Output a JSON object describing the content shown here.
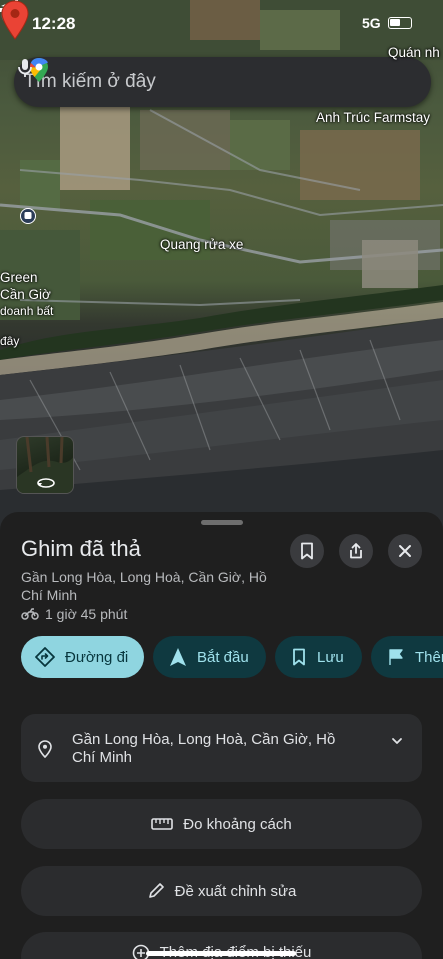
{
  "status_bar": {
    "time": "12:28",
    "network": "5G"
  },
  "search": {
    "placeholder": "Tìm kiếm ở đây"
  },
  "map": {
    "labels": {
      "quan_nh": "Quán nh",
      "anh_truc": "Anh Trúc Farmstay",
      "quang_rua_xe": "Quang rửa xe",
      "green": "Green",
      "can_gio": "Cần Giờ",
      "doanh_bat": "doanh bất",
      "day": "đây"
    }
  },
  "place": {
    "title": "Ghim đã thả",
    "address": "Gần Long Hòa, Long Hoà, Cần Giờ, Hồ Chí Minh",
    "travel_time": "1 giờ 45 phút",
    "travel_icon": "motorbike-icon"
  },
  "chips": {
    "directions": "Đường đi",
    "start": "Bắt đầu",
    "save": "Lưu",
    "more": "Thên"
  },
  "address_card": {
    "text": "Gần Long Hòa, Long Hoà, Cần Giờ, Hồ Chí Minh"
  },
  "actions": {
    "measure": "Đo khoảng cách",
    "suggest_edit": "Đề xuất chỉnh sửa",
    "add_place": "Thêm địa điểm bị thiếu"
  },
  "colors": {
    "accent": "#8fd5e0",
    "chip_bg": "#0f3940",
    "pin_red": "#ea4335",
    "sheet_bg": "#1f1f1f"
  }
}
